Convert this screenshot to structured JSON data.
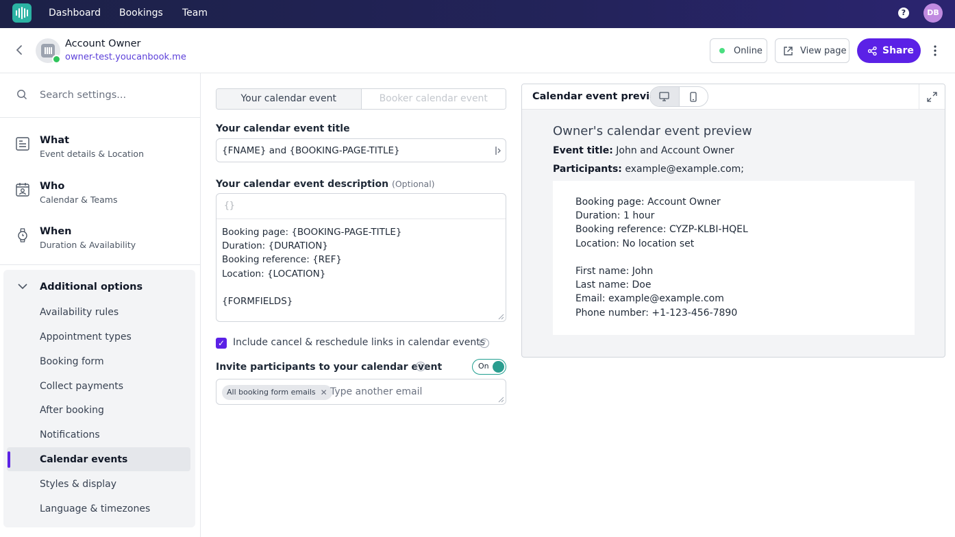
{
  "nav": {
    "links": [
      "Dashboard",
      "Bookings",
      "Team"
    ],
    "help_icon": "?",
    "avatar_initials": "DB"
  },
  "header": {
    "owner_name": "Account Owner",
    "owner_url": "owner-test.youcanbook.me",
    "status_label": "Online",
    "view_page_label": "View page",
    "share_label": "Share"
  },
  "sidebar": {
    "search_placeholder": "Search settings...",
    "sections": [
      {
        "title": "What",
        "subtitle": "Event details & Location",
        "icon": "document-icon"
      },
      {
        "title": "Who",
        "subtitle": "Calendar & Teams",
        "icon": "calendar-person-icon"
      },
      {
        "title": "When",
        "subtitle": "Duration & Availability",
        "icon": "watch-icon"
      }
    ],
    "additional_title": "Additional options",
    "options": [
      "Availability rules",
      "Appointment types",
      "Booking form",
      "Collect payments",
      "After booking",
      "Notifications",
      "Calendar events",
      "Styles & display",
      "Language & timezones"
    ],
    "active_option": "Calendar events"
  },
  "form": {
    "tabs": [
      "Your calendar event",
      "Booker calendar event"
    ],
    "title_label": "Your calendar event title",
    "title_value": "{FNAME} and {BOOKING-PAGE-TITLE}",
    "description_label": "Your calendar event description",
    "description_optional": "(Optional)",
    "description_toolbar": "{}",
    "description_value": "Booking page: {BOOKING-PAGE-TITLE}\nDuration: {DURATION}\nBooking reference: {REF}\nLocation: {LOCATION}\n\n{FORMFIELDS}",
    "include_links_label": "Include cancel & reschedule links in calendar events",
    "include_links_checked": true,
    "invite_label": "Invite participants to your calendar event",
    "invite_toggle": "On",
    "invite_chip": "All booking form emails",
    "invite_placeholder": "Type another email"
  },
  "preview": {
    "title": "Calendar event preview",
    "heading": "Owner's calendar event preview",
    "event_title_label": "Event title:",
    "event_title_value": "John and Account Owner",
    "participants_label": "Participants:",
    "participants_value": "example@example.com;",
    "body": "Booking page: Account Owner\nDuration: 1 hour\nBooking reference: CYZP-KLBI-HQEL\nLocation: No location set\n\nFirst name: John\nLast name: Doe\nEmail: example@example.com\nPhone number: +1-123-456-7890"
  },
  "colors": {
    "accent": "#5b21e6",
    "nav_bg": "#1c2147",
    "online": "#4ade80",
    "toggle": "#2a9d8f"
  }
}
